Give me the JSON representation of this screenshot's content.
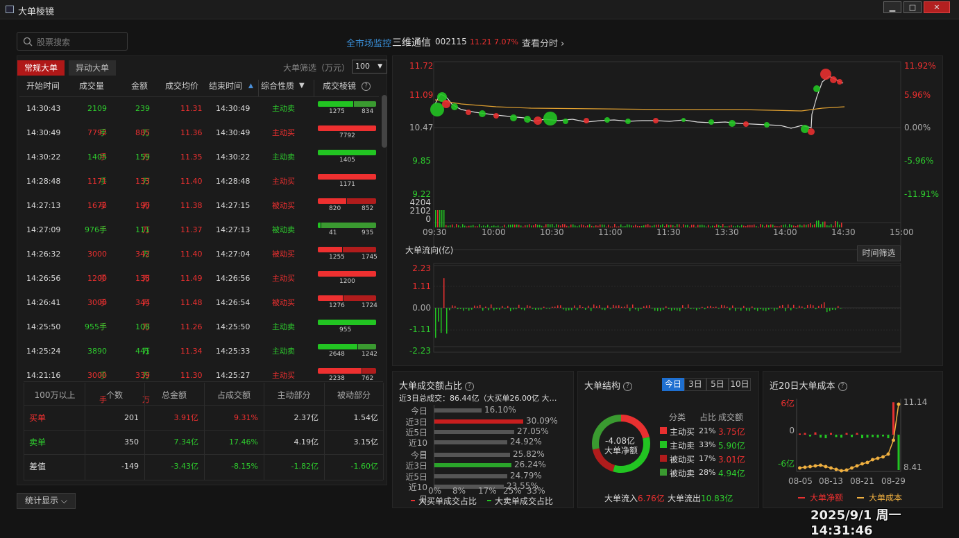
{
  "window": {
    "title": "大单棱镜",
    "min": "▁",
    "max": "□",
    "close": "✕"
  },
  "search": {
    "placeholder": "股票搜索"
  },
  "tabs": {
    "regular": "常规大单",
    "abnormal": "异动大单"
  },
  "filter": {
    "label": "大单筛选（万元）",
    "value": "100"
  },
  "columns": [
    "开始时间",
    "成交量",
    "金额",
    "成交均价",
    "结束时间",
    "综合性质",
    "成交棱镜"
  ],
  "rows": [
    {
      "start": "14:30:43",
      "vol": "2109手",
      "amt": "239万",
      "price": "11.31",
      "end": "14:30:49",
      "type": "主动卖",
      "dir": "sell",
      "a": 1275,
      "b": 834
    },
    {
      "start": "14:30:49",
      "vol": "7792手",
      "amt": "885万",
      "price": "11.36",
      "end": "14:30:49",
      "type": "主动买",
      "dir": "buy",
      "a": 7792,
      "b": 0
    },
    {
      "start": "14:30:22",
      "vol": "1405手",
      "amt": "159万",
      "price": "11.35",
      "end": "14:30:22",
      "type": "主动卖",
      "dir": "sell",
      "a": 1405,
      "b": 0
    },
    {
      "start": "14:28:48",
      "vol": "1171手",
      "amt": "133万",
      "price": "11.40",
      "end": "14:28:48",
      "type": "主动买",
      "dir": "buy",
      "a": 1171,
      "b": 0
    },
    {
      "start": "14:27:13",
      "vol": "1672手",
      "amt": "190万",
      "price": "11.38",
      "end": "14:27:15",
      "type": "被动买",
      "dir": "buy",
      "a": 820,
      "b": 852
    },
    {
      "start": "14:27:09",
      "vol": "976手",
      "amt": "111万",
      "price": "11.37",
      "end": "14:27:13",
      "type": "被动卖",
      "dir": "sell",
      "a": 41,
      "b": 935
    },
    {
      "start": "14:26:32",
      "vol": "3000手",
      "amt": "342万",
      "price": "11.40",
      "end": "14:27:04",
      "type": "被动买",
      "dir": "buy",
      "a": 1255,
      "b": 1745
    },
    {
      "start": "14:26:56",
      "vol": "1200手",
      "amt": "138万",
      "price": "11.49",
      "end": "14:26:56",
      "type": "主动买",
      "dir": "buy",
      "a": 1200,
      "b": 0
    },
    {
      "start": "14:26:41",
      "vol": "3000手",
      "amt": "344万",
      "price": "11.48",
      "end": "14:26:54",
      "type": "被动买",
      "dir": "buy",
      "a": 1276,
      "b": 1724
    },
    {
      "start": "14:25:50",
      "vol": "955手",
      "amt": "108万",
      "price": "11.26",
      "end": "14:25:50",
      "type": "主动卖",
      "dir": "sell",
      "a": 955,
      "b": 0
    },
    {
      "start": "14:25:24",
      "vol": "3890手",
      "amt": "441万",
      "price": "11.34",
      "end": "14:25:33",
      "type": "主动卖",
      "dir": "sell",
      "a": 2648,
      "b": 1242
    },
    {
      "start": "14:21:16",
      "vol": "3000手",
      "amt": "339万",
      "price": "11.30",
      "end": "14:25:27",
      "type": "主动买",
      "dir": "buy",
      "a": 2238,
      "b": 762
    }
  ],
  "summary": {
    "headers": [
      "100万以上",
      "个数",
      "总金额",
      "占成交额",
      "主动部分",
      "被动部分"
    ],
    "rows": [
      {
        "label": "买单",
        "count": "201",
        "total": "3.91亿",
        "ratio": "9.31%",
        "active": "2.37亿",
        "passive": "1.54亿",
        "c": "red"
      },
      {
        "label": "卖单",
        "count": "350",
        "total": "7.34亿",
        "ratio": "17.46%",
        "active": "4.19亿",
        "passive": "3.15亿",
        "c": "green"
      },
      {
        "label": "差值",
        "count": "-149",
        "total": "-3.43亿",
        "ratio": "-8.15%",
        "active": "-1.82亿",
        "passive": "-1.60亿",
        "c": "diff"
      }
    ]
  },
  "stats_button": "统计显示",
  "stock": {
    "market_link": "全市场监控",
    "name": "三维通信",
    "code": "002115",
    "price": "11.21",
    "pct": "7.07%",
    "view_minute": "查看分时"
  },
  "intraday": {
    "price_ticks": [
      "11.72",
      "11.09",
      "10.47",
      "9.85",
      "9.22"
    ],
    "pct_ticks": [
      "11.92%",
      "5.96%",
      "0.00%",
      "-5.96%",
      "-11.91%"
    ],
    "vol_ticks": [
      "4204",
      "2102",
      "0"
    ],
    "time_ticks": [
      "09:30",
      "10:00",
      "10:30",
      "11:00",
      "11:30",
      "13:30",
      "14:00",
      "14:30",
      "15:00"
    ]
  },
  "flow": {
    "title": "大单流向(亿)",
    "filter_button": "时间筛选",
    "ticks": [
      "2.23",
      "1.11",
      "0.00",
      "-1.11",
      "-2.23"
    ]
  },
  "share": {
    "title": "大单成交额占比",
    "desc": "近3日总成交：86.44亿（大买单26.00亿  大…",
    "buy_periods": [
      "今日",
      "近3日",
      "近5日",
      "近10日"
    ],
    "buy_values": [
      "16.10%",
      "30.09%",
      "27.05%",
      "24.92%"
    ],
    "sell_periods": [
      "今日",
      "近3日",
      "近5日",
      "近10日"
    ],
    "sell_values": [
      "25.82%",
      "26.24%",
      "24.79%",
      "23.55%"
    ],
    "x_ticks": [
      "0%",
      "8%",
      "17%",
      "25%",
      "33%"
    ],
    "legend_buy": "大买单成交占比",
    "legend_sell": "大卖单成交占比"
  },
  "structure": {
    "title": "大单结构",
    "periods": [
      "今日",
      "3日",
      "5日",
      "10日"
    ],
    "center_value": "-4.08亿",
    "center_label": "大单净额",
    "header": [
      "分类",
      "占比",
      "成交额"
    ],
    "items": [
      {
        "name": "主动买",
        "pct": "21%",
        "amt": "3.75亿",
        "color": "#e83030"
      },
      {
        "name": "主动卖",
        "pct": "33%",
        "amt": "5.90亿",
        "color": "#22c422"
      },
      {
        "name": "被动买",
        "pct": "17%",
        "amt": "3.01亿",
        "color": "#b01c1c"
      },
      {
        "name": "被动卖",
        "pct": "28%",
        "amt": "4.94亿",
        "color": "#3a9a30"
      }
    ],
    "inflow_label": "大单流入",
    "inflow": "6.76亿",
    "outflow_label": "大单流出",
    "outflow": "10.83亿"
  },
  "cost": {
    "title": "近20日大单成本",
    "left_ticks": [
      "6亿",
      "0",
      "-6亿"
    ],
    "right_ticks": [
      "11.14",
      "8.41"
    ],
    "dates": [
      "08-05",
      "08-13",
      "08-21",
      "08-29"
    ],
    "legend_net": "大单净额",
    "legend_cost": "大单成本"
  },
  "clock": "2025/9/1 周一 14:31:46"
}
